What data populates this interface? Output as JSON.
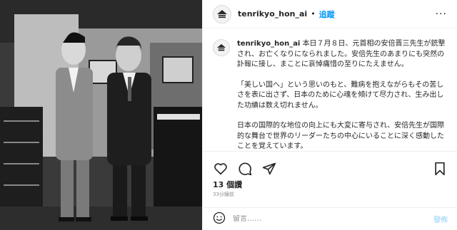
{
  "post": {
    "username": "tenrikyo_hon_ai",
    "separator": "•",
    "follow_label": "追蹤",
    "more_label": "···"
  },
  "caption": {
    "username": "tenrikyo_hon_ai",
    "paragraphs": [
      "本日７月８日、元首相の安倍晋三先生が銃撃され、お亡くなりになられました。安倍先生のあまりにも突然の訃報に接し、まことに哀悼痛惜の至りにたえません。",
      "「美しい国へ」という思いのもと、難病を抱えながらもその苦しさを表に出さず、日本のために心魂を傾けて尽力され、生み出した功績は数え切れません。",
      "日本の国際的な地位の向上にも大変に寄与され、安倍先生が国際的な舞台で世界のリーダーたちの中心にいることに深く感動したことを覚えています。"
    ]
  },
  "likes_label": "13 個讚",
  "time_label": "33分鐘前",
  "comment": {
    "placeholder": "留言……",
    "post_label": "發佈"
  },
  "colors": {
    "accent": "#0095f6",
    "post_disabled": "#b2dffc",
    "muted": "#8e8e8e"
  },
  "icons": [
    "heart-icon",
    "comment-icon",
    "share-icon",
    "bookmark-icon",
    "emoji-icon",
    "more-icon"
  ]
}
